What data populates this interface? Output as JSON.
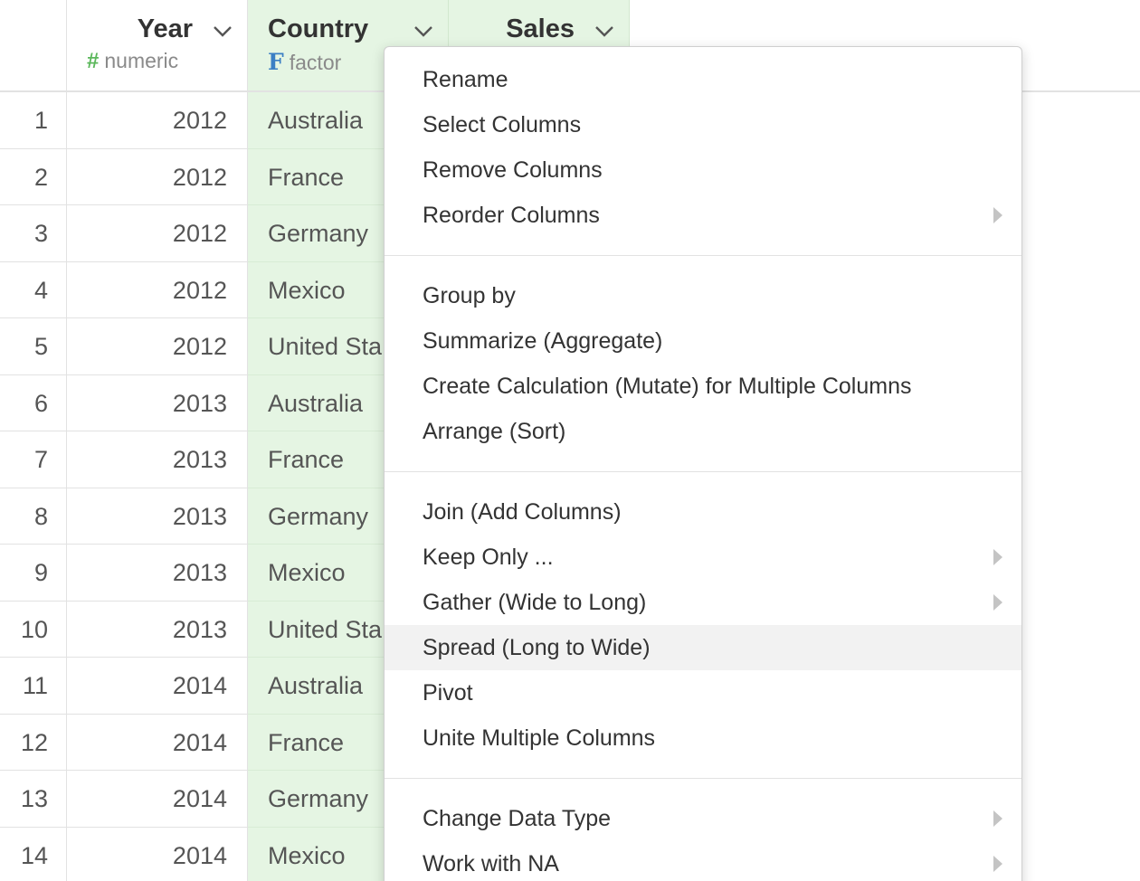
{
  "columns": {
    "year": {
      "name": "Year",
      "type_label": "numeric",
      "type_glyph": "#"
    },
    "country": {
      "name": "Country",
      "type_label": "factor",
      "type_glyph": "F"
    },
    "sales": {
      "name": "Sales"
    }
  },
  "rows": [
    {
      "idx": "1",
      "year": "2012",
      "country": "Australia"
    },
    {
      "idx": "2",
      "year": "2012",
      "country": "France"
    },
    {
      "idx": "3",
      "year": "2012",
      "country": "Germany"
    },
    {
      "idx": "4",
      "year": "2012",
      "country": "Mexico"
    },
    {
      "idx": "5",
      "year": "2012",
      "country": "United Sta"
    },
    {
      "idx": "6",
      "year": "2013",
      "country": "Australia"
    },
    {
      "idx": "7",
      "year": "2013",
      "country": "France"
    },
    {
      "idx": "8",
      "year": "2013",
      "country": "Germany"
    },
    {
      "idx": "9",
      "year": "2013",
      "country": "Mexico"
    },
    {
      "idx": "10",
      "year": "2013",
      "country": "United Sta"
    },
    {
      "idx": "11",
      "year": "2014",
      "country": "Australia"
    },
    {
      "idx": "12",
      "year": "2014",
      "country": "France"
    },
    {
      "idx": "13",
      "year": "2014",
      "country": "Germany"
    },
    {
      "idx": "14",
      "year": "2014",
      "country": "Mexico"
    }
  ],
  "menu": {
    "groups": [
      [
        {
          "label": "Rename",
          "submenu": false
        },
        {
          "label": "Select Columns",
          "submenu": false
        },
        {
          "label": "Remove Columns",
          "submenu": false
        },
        {
          "label": "Reorder Columns",
          "submenu": true
        }
      ],
      [
        {
          "label": "Group by",
          "submenu": false
        },
        {
          "label": "Summarize (Aggregate)",
          "submenu": false
        },
        {
          "label": "Create Calculation (Mutate) for Multiple Columns",
          "submenu": false
        },
        {
          "label": "Arrange (Sort)",
          "submenu": false
        }
      ],
      [
        {
          "label": "Join (Add Columns)",
          "submenu": false
        },
        {
          "label": "Keep Only ...",
          "submenu": true
        },
        {
          "label": "Gather (Wide to Long)",
          "submenu": true
        },
        {
          "label": "Spread (Long to Wide)",
          "submenu": false,
          "highlighted": true
        },
        {
          "label": "Pivot",
          "submenu": false
        },
        {
          "label": "Unite Multiple Columns",
          "submenu": false
        }
      ],
      [
        {
          "label": "Change Data Type",
          "submenu": true
        },
        {
          "label": "Work with NA",
          "submenu": true
        }
      ]
    ]
  },
  "colors": {
    "selected_column_bg": "#e5f5e3",
    "numeric_glyph": "#5cb85c",
    "factor_glyph": "#3b7fc4",
    "menu_highlight": "#f2f2f2"
  },
  "icons": {
    "column_menu": "chevron-down-icon",
    "submenu": "caret-right-icon"
  }
}
